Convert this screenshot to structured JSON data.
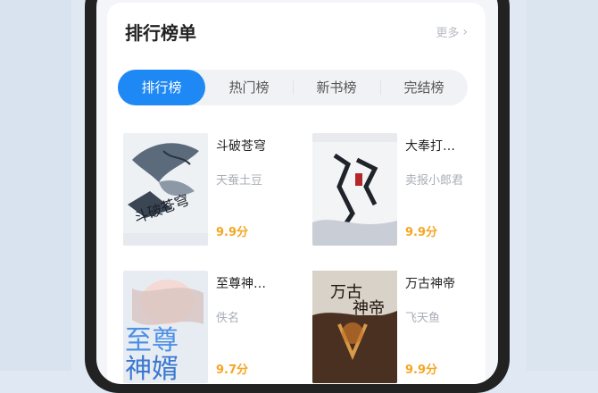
{
  "ranking": {
    "title": "排行榜单",
    "more_label": "更多",
    "tabs": [
      {
        "label": "排行榜",
        "active": true
      },
      {
        "label": "热门榜",
        "active": false
      },
      {
        "label": "新书榜",
        "active": false
      },
      {
        "label": "完结榜",
        "active": false
      }
    ],
    "books": [
      {
        "name": "斗破苍穹",
        "author": "天蚕土豆",
        "score": "9.9分"
      },
      {
        "name": "大奉打…",
        "author": "卖报小郎君",
        "score": "9.9分"
      },
      {
        "name": "至尊神…",
        "author": "佚名",
        "score": "9.7分"
      },
      {
        "name": "万古神帝",
        "author": "飞天鱼",
        "score": "9.9分"
      }
    ]
  },
  "colors": {
    "accent": "#1e88f5",
    "score": "#f5a623"
  }
}
